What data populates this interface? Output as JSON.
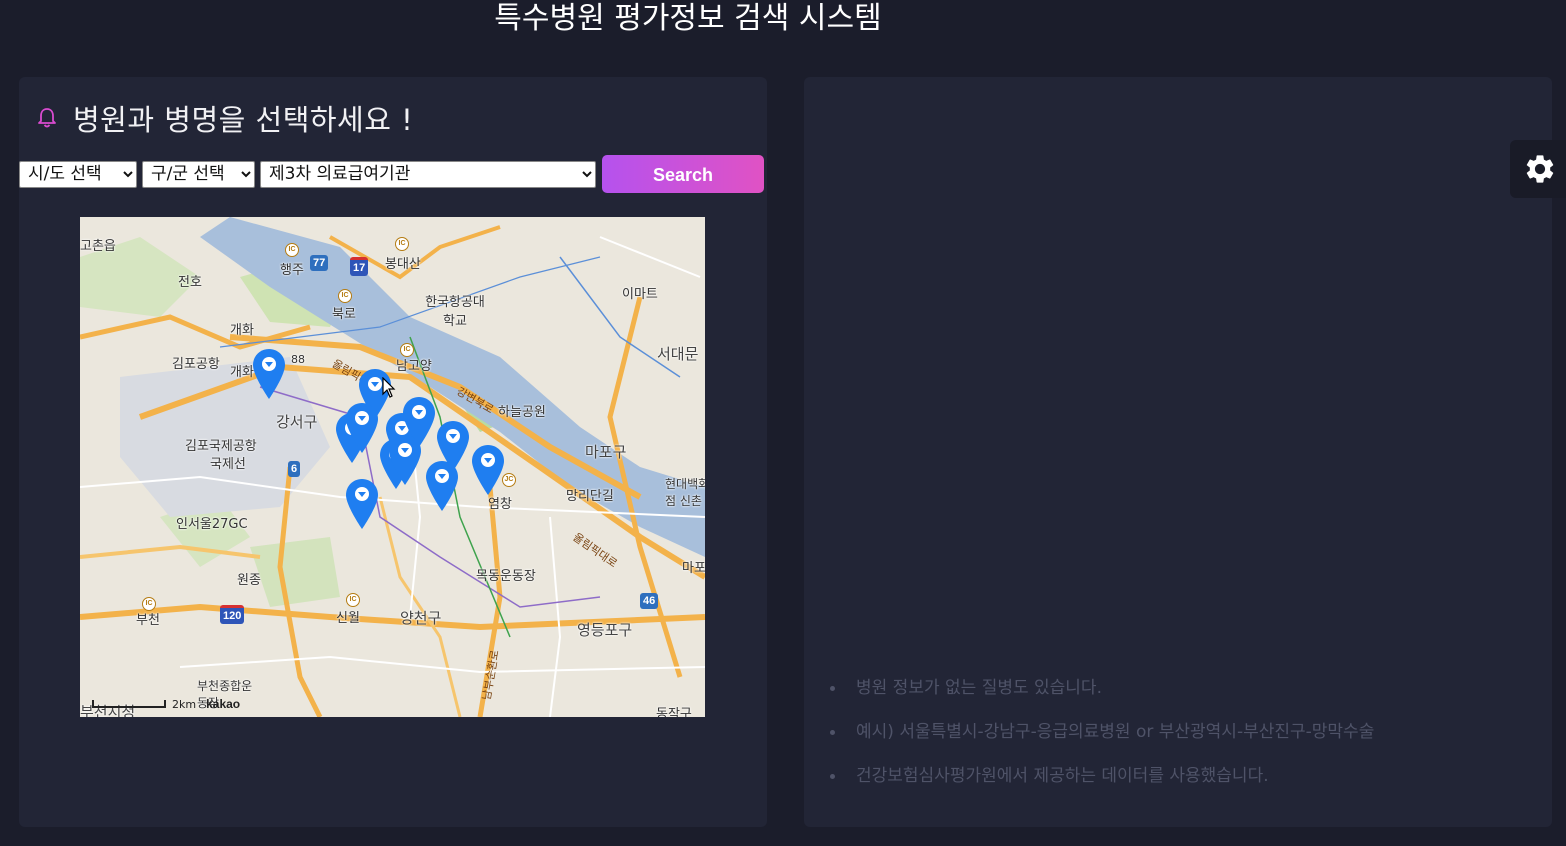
{
  "header": {
    "title": "특수병원 평가정보 검색 시스템"
  },
  "left_panel": {
    "title": "병원과 병명을 선택하세요 !",
    "sido_select": {
      "selected": "시/도 선택"
    },
    "gugun_select": {
      "selected": "구/군 선택"
    },
    "type_select": {
      "selected": "제3차 의료급여기관"
    },
    "search_button": "Search"
  },
  "map": {
    "labels": [
      "고촌읍",
      "전호",
      "행주",
      "봉대산",
      "북로",
      "한국항공대학교",
      "이마트",
      "개화",
      "김포공항",
      "개화",
      "88",
      "남고양",
      "서대문",
      "강서구",
      "하늘공원",
      "김포국제공항",
      "국제선",
      "마포구",
      "망리단길",
      "현대백화점 신촌",
      "염창",
      "인서울27GC",
      "원종",
      "목동운동장",
      "부천",
      "신월",
      "양천구",
      "영등포구",
      "부천종합운동장",
      "부천시청",
      "동작구",
      "마포"
    ],
    "road_labels": [
      "올림픽대로",
      "강변북로",
      "올림픽대로",
      "남부순환로"
    ],
    "shields": [
      "77",
      "17",
      "6",
      "120",
      "46"
    ],
    "scale_text": "2km",
    "attribution": "kakao",
    "marker_count": 12
  },
  "right_panel": {
    "notes": [
      "병원 정보가 없는 질병도 있습니다.",
      "예시) 서울특별시-강남구-응급의료병원 or 부산광역시-부산진구-망막수술",
      "건강보험심사평가원에서 제공하는 데이터를 사용했습니다."
    ]
  },
  "colors": {
    "background": "#1b1d2b",
    "panel": "#222536",
    "accent_gradient_start": "#b552ee",
    "accent_gradient_end": "#e052c4",
    "marker": "#1f7ef0",
    "bell": "#d94bd0"
  },
  "icons": {
    "title_icon": "bell-icon",
    "settings_icon": "gear-icon",
    "marker_icon": "map-marker-icon"
  }
}
